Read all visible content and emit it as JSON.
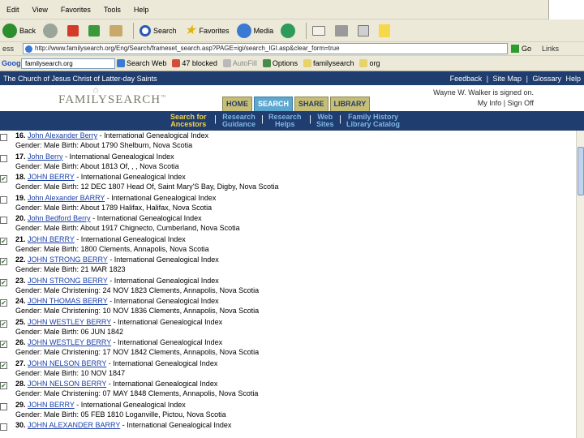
{
  "menubar": {
    "items": [
      "Edit",
      "View",
      "Favorites",
      "Tools",
      "Help"
    ]
  },
  "toolbar": {
    "back_label": "Back",
    "search_label": "Search",
    "favorites_label": "Favorites",
    "media_label": "Media"
  },
  "address": {
    "label": "ess",
    "url": "http://www.familysearch.org/Eng/Search/frameset_search.asp?PAGE=igi/search_IGI.asp&clear_form=true",
    "go_label": "Go",
    "links_label": "Links"
  },
  "google": {
    "logo": "Google",
    "search_value": "familysearch.org",
    "buttons": [
      "Search Web",
      "47 blocked",
      "AutoFill",
      "Options",
      "familysearch",
      "org"
    ]
  },
  "lds_bar": {
    "title": "The Church of Jesus Christ of Latter-day Saints",
    "links": [
      "Feedback",
      "|",
      "Site Map",
      "|",
      "Glossary",
      "Help"
    ]
  },
  "header": {
    "logo": "FAMILYSEARCH",
    "tabs": [
      "HOME",
      "SEARCH",
      "SHARE",
      "LIBRARY"
    ],
    "active_tab": "SEARCH",
    "signed_in": "Wayne W. Walker is signed on.",
    "my_info": "My Info",
    "sign_off": "Sign Off"
  },
  "subnav": {
    "items": [
      {
        "l1": "Search for",
        "l2": "Ancestors"
      },
      {
        "l1": "Research",
        "l2": "Guidance"
      },
      {
        "l1": "Research",
        "l2": "Helps"
      },
      {
        "l1": "Web",
        "l2": "Sites"
      },
      {
        "l1": "Family History",
        "l2": "Library Catalog"
      }
    ]
  },
  "results": [
    {
      "num": "16.",
      "name": "John Alexander Berry",
      "source": " - International Genealogical Index",
      "detail": "Gender: Male Birth: About 1790 Shelburn, Nova Scotia",
      "checked": false
    },
    {
      "num": "17.",
      "name": "John Berry",
      "source": " - International Genealogical Index",
      "detail": "Gender: Male Birth: About 1813 Of, , , Nova Scotia",
      "checked": false
    },
    {
      "num": "18.",
      "name": "JOHN BERRY",
      "source": " - International Genealogical Index",
      "detail": "Gender: Male Birth: 12 DEC 1807 Head Of, Saint Mary'S Bay, Digby, Nova Scotia",
      "checked": true
    },
    {
      "num": "19.",
      "name": "John Alexander BARRY",
      "source": " - International Genealogical Index",
      "detail": "Gender: Male Birth: About 1789 Halifax, Halifax, Nova Scotia",
      "checked": false
    },
    {
      "num": "20.",
      "name": "John Bedford Berry",
      "source": " - International Genealogical Index",
      "detail": "Gender: Male Birth: About 1917 Chignecto, Cumberland, Nova Scotia",
      "checked": false
    },
    {
      "num": "21.",
      "name": "JOHN BERRY",
      "source": " - International Genealogical Index",
      "detail": "Gender: Male Birth: 1800 Clements, Annapolis, Nova Scotia",
      "checked": true
    },
    {
      "num": "22.",
      "name": "JOHN STRONG BERRY",
      "source": " - International Genealogical Index",
      "detail": "Gender: Male Birth: 21 MAR 1823",
      "checked": true
    },
    {
      "num": "23.",
      "name": "JOHN STRONG BERRY",
      "source": " - International Genealogical Index",
      "detail": "Gender: Male Christening: 24 NOV 1823 Clements, Annapolis, Nova Scotia",
      "checked": true
    },
    {
      "num": "24.",
      "name": "JOHN THOMAS BERRY",
      "source": " - International Genealogical Index",
      "detail": "Gender: Male Christening: 10 NOV 1836 Clements, Annapolis, Nova Scotia",
      "checked": true
    },
    {
      "num": "25.",
      "name": "JOHN WESTLEY BERRY",
      "source": " - International Genealogical Index",
      "detail": "Gender: Male Birth: 06 JUN 1842",
      "checked": true
    },
    {
      "num": "26.",
      "name": "JOHN WESTLEY BERRY",
      "source": " - International Genealogical Index",
      "detail": "Gender: Male Christening: 17 NOV 1842 Clements, Annapolis, Nova Scotia",
      "checked": true
    },
    {
      "num": "27.",
      "name": "JOHN NELSON BERRY",
      "source": " - International Genealogical Index",
      "detail": "Gender: Male Birth: 10 NOV 1847",
      "checked": true
    },
    {
      "num": "28.",
      "name": "JOHN NELSON BERRY",
      "source": " - International Genealogical Index",
      "detail": "Gender: Male Christening: 07 MAY 1848 Clements, Annapolis, Nova Scotia",
      "checked": true
    },
    {
      "num": "29.",
      "name": "JOHN BERRY",
      "source": " - International Genealogical Index",
      "detail": "Gender: Male Birth: 05 FEB 1810 Loganville, Pictou, Nova Scotia",
      "checked": false
    },
    {
      "num": "30.",
      "name": "JOHN ALEXANDER BARRY",
      "source": " - International Genealogical Index",
      "detail": "",
      "checked": false
    }
  ]
}
